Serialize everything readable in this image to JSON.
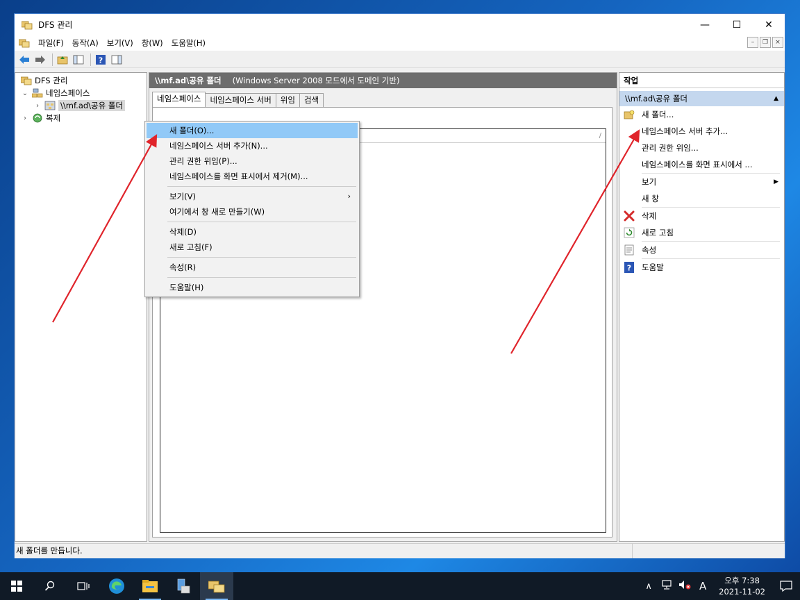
{
  "window": {
    "title": "DFS 관리",
    "minimize": "—",
    "maximize": "☐",
    "close": "✕"
  },
  "menubar": {
    "items": [
      "파일(F)",
      "동작(A)",
      "보기(V)",
      "창(W)",
      "도움말(H)"
    ]
  },
  "tree": {
    "root": "DFS 관리",
    "namespaces": "네임스페이스",
    "selected_namespace": "\\\\mf.ad\\공유 폴더",
    "replication": "복제"
  },
  "center": {
    "header_title": "\\\\mf.ad\\공유 폴더",
    "header_subtitle": "(Windows Server 2008 모드에서 도메인 기반)",
    "tabs": [
      "네임스페이스",
      "네임스페이스 서버",
      "위임",
      "검색"
    ]
  },
  "context_menu": {
    "items": [
      "새 폴더(O)...",
      "네임스페이스 서버 추가(N)...",
      "관리 권한 위임(P)...",
      "네임스페이스를 화면 표시에서 제거(M)...",
      "보기(V)",
      "여기에서 창 새로 만들기(W)",
      "삭제(D)",
      "새로 고침(F)",
      "속성(R)",
      "도움말(H)"
    ],
    "submenu_arrow": "›"
  },
  "actions": {
    "title": "작업",
    "section": "\\\\mf.ad\\공유 폴더",
    "section_arrow": "▲",
    "items": [
      "새 폴더...",
      "네임스페이스 서버 추가...",
      "관리 권한 위임...",
      "네임스페이스를 화면 표시에서 ...",
      "보기",
      "새 창",
      "삭제",
      "새로 고침",
      "속성",
      "도움말"
    ]
  },
  "statusbar": {
    "text": "새 폴더를 만듭니다."
  },
  "taskbar": {
    "tray_chevron": "∧",
    "ime": "A",
    "time": "오후 7:38",
    "date": "2021-11-02"
  },
  "colors": {
    "annotation_arrow": "#e0242b",
    "menu_highlight": "#91c9f7",
    "section_bg": "#c4d7ee"
  }
}
